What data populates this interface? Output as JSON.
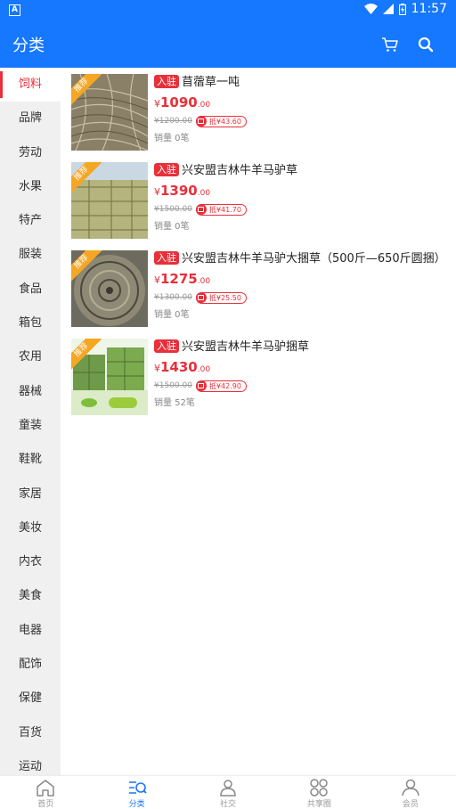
{
  "status_bar": {
    "time": "11:57",
    "notification_badge": "A"
  },
  "app_bar": {
    "title": "分类",
    "icons": [
      "cart-icon",
      "search-icon"
    ]
  },
  "sidebar": {
    "items": [
      {
        "label": "饲料",
        "active": true
      },
      {
        "label": "品牌"
      },
      {
        "label": "劳动"
      },
      {
        "label": "水果"
      },
      {
        "label": "特产"
      },
      {
        "label": "服装"
      },
      {
        "label": "食品"
      },
      {
        "label": "箱包"
      },
      {
        "label": "农用"
      },
      {
        "label": "器械"
      },
      {
        "label": "童装"
      },
      {
        "label": "鞋靴"
      },
      {
        "label": "家居"
      },
      {
        "label": "美妆"
      },
      {
        "label": "内衣"
      },
      {
        "label": "美食"
      },
      {
        "label": "电器"
      },
      {
        "label": "配饰"
      },
      {
        "label": "保健"
      },
      {
        "label": "百货"
      },
      {
        "label": "运动"
      }
    ]
  },
  "products": [
    {
      "ribbon": "推荐",
      "tag": "入驻",
      "name": "苜蓿草一吨",
      "currency": "¥",
      "price": "1090",
      "cents": ".00",
      "original_price": "¥1200.00",
      "coupon": "抵¥43.60",
      "sales": "销量 0笔"
    },
    {
      "ribbon": "推荐",
      "tag": "入驻",
      "name": "兴安盟吉林牛羊马驴草",
      "currency": "¥",
      "price": "1390",
      "cents": ".00",
      "original_price": "¥1500.00",
      "coupon": "抵¥41.70",
      "sales": "销量 0笔"
    },
    {
      "ribbon": "推荐",
      "tag": "入驻",
      "name": "兴安盟吉林牛羊马驴大捆草（500斤—650斤圆捆）",
      "currency": "¥",
      "price": "1275",
      "cents": ".00",
      "original_price": "¥1300.00",
      "coupon": "抵¥25.50",
      "sales": "销量 0笔"
    },
    {
      "ribbon": "推荐",
      "tag": "入驻",
      "name": "兴安盟吉林牛羊马驴捆草",
      "currency": "¥",
      "price": "1430",
      "cents": ".00",
      "original_price": "¥1500.00",
      "coupon": "抵¥42.90",
      "sales": "销量 52笔"
    }
  ],
  "tab_bar": {
    "tabs": [
      {
        "label": "首页",
        "icon": "home-icon"
      },
      {
        "label": "分类",
        "icon": "category-icon",
        "active": true
      },
      {
        "label": "社交",
        "icon": "social-icon"
      },
      {
        "label": "共享圈",
        "icon": "share-circle-icon"
      },
      {
        "label": "会员",
        "icon": "member-icon"
      }
    ]
  },
  "colors": {
    "primary": "#1677ff",
    "accent": "#e8303a",
    "ribbon": "#f5a623"
  }
}
